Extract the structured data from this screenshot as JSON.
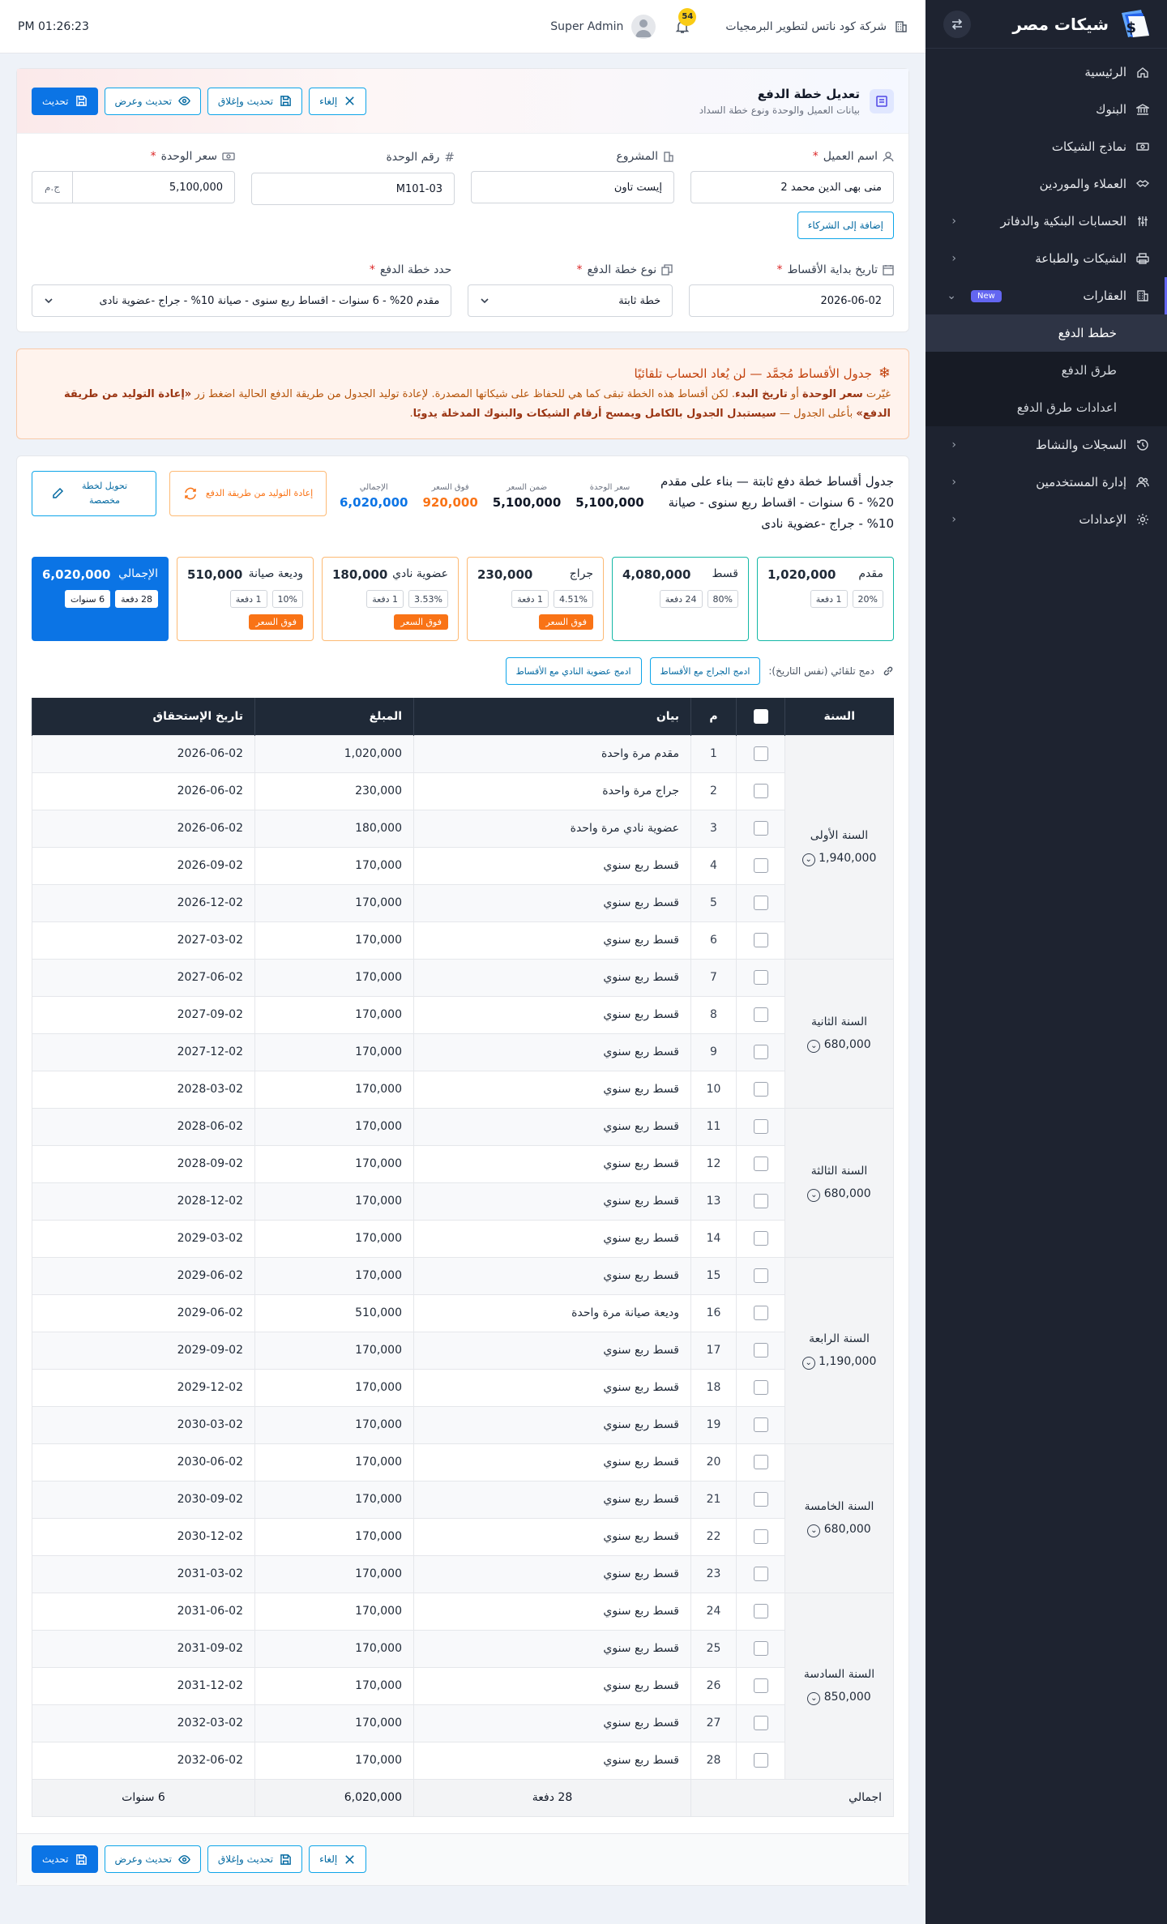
{
  "sidebar": {
    "brand": "شيكات مصر",
    "items": [
      {
        "label": "الرئيسية",
        "icon": "home-icon",
        "chevron": false
      },
      {
        "label": "البنوك",
        "icon": "bank-icon",
        "chevron": false
      },
      {
        "label": "نماذج الشيكات",
        "icon": "cheque-icon",
        "chevron": false
      },
      {
        "label": "العملاء والموردين",
        "icon": "handshake-icon",
        "chevron": false
      },
      {
        "label": "الحسابات البنكية والدفاتر",
        "icon": "sliders-icon",
        "chevron": true
      },
      {
        "label": "الشيكات والطباعة",
        "icon": "printer-icon",
        "chevron": true
      },
      {
        "label": "العقارات",
        "icon": "building-icon",
        "chevron": true,
        "badge": "New"
      }
    ],
    "sub_items": [
      "خطط الدفع",
      "طرق الدفع",
      "اعدادات طرق الدفع"
    ],
    "items_after": [
      {
        "label": "السجلات والنشاط",
        "icon": "history-icon"
      },
      {
        "label": "إدارة المستخدمين",
        "icon": "users-icon"
      },
      {
        "label": "الإعدادات",
        "icon": "gear-icon"
      }
    ]
  },
  "topbar": {
    "time": "PM 01:26:23",
    "company": "شركة كود ناتس لتطوير البرمجيات",
    "notifications": "54",
    "user": "Super Admin"
  },
  "form": {
    "title": "تعديل خطة الدفع",
    "subtitle": "بيانات العميل والوحدة ونوع خطة السداد",
    "buttons": {
      "cancel": "إلغاء",
      "update_close": "تحديث وإغلاق",
      "update_view": "تحديث وعرض",
      "update": "تحديث"
    },
    "fields": {
      "client_label": "اسم العميل",
      "client_value": "منى بهى الدين محمد 2",
      "project_label": "المشروع",
      "project_value": "إيست تاون",
      "unit_no_label": "رقم الوحدة",
      "unit_no_value": "M101-03",
      "unit_price_label": "سعر الوحدة",
      "unit_price_value": "5,100,000",
      "currency": "ج.م",
      "add_partners": "إضافة إلى الشركاء",
      "start_label": "تاريخ بداية الأقساط",
      "start_value": "2026-06-02",
      "type_label": "نوع خطة الدفع",
      "type_value": "خطة ثابتة",
      "plan_label": "حدد خطة الدفع",
      "plan_value": "مقدم 20% - 6 سنوات - اقساط ربع سنوى - صيانة 10% - جراج -عضوية نادى"
    }
  },
  "alert": {
    "title": "جدول الأقساط مُجمَّد — لن يُعاد الحساب تلقائيًا",
    "p1": "غيّرت ",
    "b1": "سعر الوحدة",
    "p2": " أو ",
    "b2": "تاريخ البدء",
    "p3": ". لكن أقساط هذه الخطة تبقى كما هي للحفاظ على شيكاتها المصدرة. لإعادة توليد الجدول من طريقة الدفع الحالية اضغط زر ",
    "b3": "«إعادة التوليد من طريقة الدفع»",
    "p4": " بأعلى الجدول — ",
    "b4": "سيستبدل الجدول بالكامل ويمسح أرقام الشيكات والبنوك المدخلة يدويًا",
    "p5": "."
  },
  "schedule": {
    "title": "جدول أقساط خطة دفع ثابتة — بناء على مقدم 20% - 6 سنوات - اقساط ربع سنوى - صيانة 10% - جراج -عضوية نادى",
    "stats": [
      {
        "k": "سعر الوحدة",
        "v": "5,100,000"
      },
      {
        "k": "ضمن السعر",
        "v": "5,100,000"
      },
      {
        "k": "فوق السعر",
        "v": "920,000"
      },
      {
        "k": "الإجمالي",
        "v": "6,020,000"
      }
    ],
    "regen_label": "إعادة التوليد من طريقة الدفع",
    "custom_label": "تحويل لخطة مخصصة",
    "components": [
      {
        "name": "مقدم",
        "amount": "1,020,000",
        "chips": [
          "20%",
          "1 دفعة"
        ],
        "tag": ""
      },
      {
        "name": "قسط",
        "amount": "4,080,000",
        "chips": [
          "80%",
          "24 دفعة"
        ],
        "tag": ""
      },
      {
        "name": "جراج",
        "amount": "230,000",
        "chips": [
          "4.51%",
          "1 دفعة"
        ],
        "tag": "فوق السعر"
      },
      {
        "name": "عضوية نادي",
        "amount": "180,000",
        "chips": [
          "3.53%",
          "1 دفعة"
        ],
        "tag": "فوق السعر"
      },
      {
        "name": "وديعة صيانة",
        "amount": "510,000",
        "chips": [
          "10%",
          "1 دفعة"
        ],
        "tag": "فوق السعر"
      },
      {
        "name": "الإجمالي",
        "amount": "6,020,000",
        "chips": [
          "28 دفعة",
          "6 سنوات"
        ],
        "tag": ""
      }
    ],
    "merge_label": "دمج تلقائي (نفس التاريخ):",
    "merge_btn1": "ادمج الجراج مع الأقساط",
    "merge_btn2": "ادمج عضوية النادي مع الأقساط",
    "headers": {
      "year": "السنة",
      "n": "م",
      "desc": "بيان",
      "amount": "المبلغ",
      "due": "تاريخ الإستحقاق"
    },
    "years": [
      {
        "label": "السنة الأولى",
        "total": "1,940,000",
        "rows": [
          {
            "n": "1",
            "desc": "مقدم مرة واحدة",
            "amount": "1,020,000",
            "due": "2026-06-02"
          },
          {
            "n": "2",
            "desc": "جراج مرة واحدة",
            "amount": "230,000",
            "due": "2026-06-02"
          },
          {
            "n": "3",
            "desc": "عضوية نادي مرة واحدة",
            "amount": "180,000",
            "due": "2026-06-02"
          },
          {
            "n": "4",
            "desc": "قسط ربع سنوي",
            "amount": "170,000",
            "due": "2026-09-02"
          },
          {
            "n": "5",
            "desc": "قسط ربع سنوي",
            "amount": "170,000",
            "due": "2026-12-02"
          },
          {
            "n": "6",
            "desc": "قسط ربع سنوي",
            "amount": "170,000",
            "due": "2027-03-02"
          }
        ]
      },
      {
        "label": "السنة الثانية",
        "total": "680,000",
        "rows": [
          {
            "n": "7",
            "desc": "قسط ربع سنوي",
            "amount": "170,000",
            "due": "2027-06-02"
          },
          {
            "n": "8",
            "desc": "قسط ربع سنوي",
            "amount": "170,000",
            "due": "2027-09-02"
          },
          {
            "n": "9",
            "desc": "قسط ربع سنوي",
            "amount": "170,000",
            "due": "2027-12-02"
          },
          {
            "n": "10",
            "desc": "قسط ربع سنوي",
            "amount": "170,000",
            "due": "2028-03-02"
          }
        ]
      },
      {
        "label": "السنة الثالثة",
        "total": "680,000",
        "rows": [
          {
            "n": "11",
            "desc": "قسط ربع سنوي",
            "amount": "170,000",
            "due": "2028-06-02"
          },
          {
            "n": "12",
            "desc": "قسط ربع سنوي",
            "amount": "170,000",
            "due": "2028-09-02"
          },
          {
            "n": "13",
            "desc": "قسط ربع سنوي",
            "amount": "170,000",
            "due": "2028-12-02"
          },
          {
            "n": "14",
            "desc": "قسط ربع سنوي",
            "amount": "170,000",
            "due": "2029-03-02"
          }
        ]
      },
      {
        "label": "السنة الرابعة",
        "total": "1,190,000",
        "rows": [
          {
            "n": "15",
            "desc": "قسط ربع سنوي",
            "amount": "170,000",
            "due": "2029-06-02"
          },
          {
            "n": "16",
            "desc": "وديعة صيانة مرة واحدة",
            "amount": "510,000",
            "due": "2029-06-02"
          },
          {
            "n": "17",
            "desc": "قسط ربع سنوي",
            "amount": "170,000",
            "due": "2029-09-02"
          },
          {
            "n": "18",
            "desc": "قسط ربع سنوي",
            "amount": "170,000",
            "due": "2029-12-02"
          },
          {
            "n": "19",
            "desc": "قسط ربع سنوي",
            "amount": "170,000",
            "due": "2030-03-02"
          }
        ]
      },
      {
        "label": "السنة الخامسة",
        "total": "680,000",
        "rows": [
          {
            "n": "20",
            "desc": "قسط ربع سنوي",
            "amount": "170,000",
            "due": "2030-06-02"
          },
          {
            "n": "21",
            "desc": "قسط ربع سنوي",
            "amount": "170,000",
            "due": "2030-09-02"
          },
          {
            "n": "22",
            "desc": "قسط ربع سنوي",
            "amount": "170,000",
            "due": "2030-12-02"
          },
          {
            "n": "23",
            "desc": "قسط ربع سنوي",
            "amount": "170,000",
            "due": "2031-03-02"
          }
        ]
      },
      {
        "label": "السنة السادسة",
        "total": "850,000",
        "rows": [
          {
            "n": "24",
            "desc": "قسط ربع سنوي",
            "amount": "170,000",
            "due": "2031-06-02"
          },
          {
            "n": "25",
            "desc": "قسط ربع سنوي",
            "amount": "170,000",
            "due": "2031-09-02"
          },
          {
            "n": "26",
            "desc": "قسط ربع سنوي",
            "amount": "170,000",
            "due": "2031-12-02"
          },
          {
            "n": "27",
            "desc": "قسط ربع سنوي",
            "amount": "170,000",
            "due": "2032-03-02"
          },
          {
            "n": "28",
            "desc": "قسط ربع سنوي",
            "amount": "170,000",
            "due": "2032-06-02"
          }
        ]
      }
    ],
    "footer": {
      "label": "اجمالي",
      "count": "28 دفعة",
      "amount": "6,020,000",
      "years": "6 سنوات"
    }
  }
}
